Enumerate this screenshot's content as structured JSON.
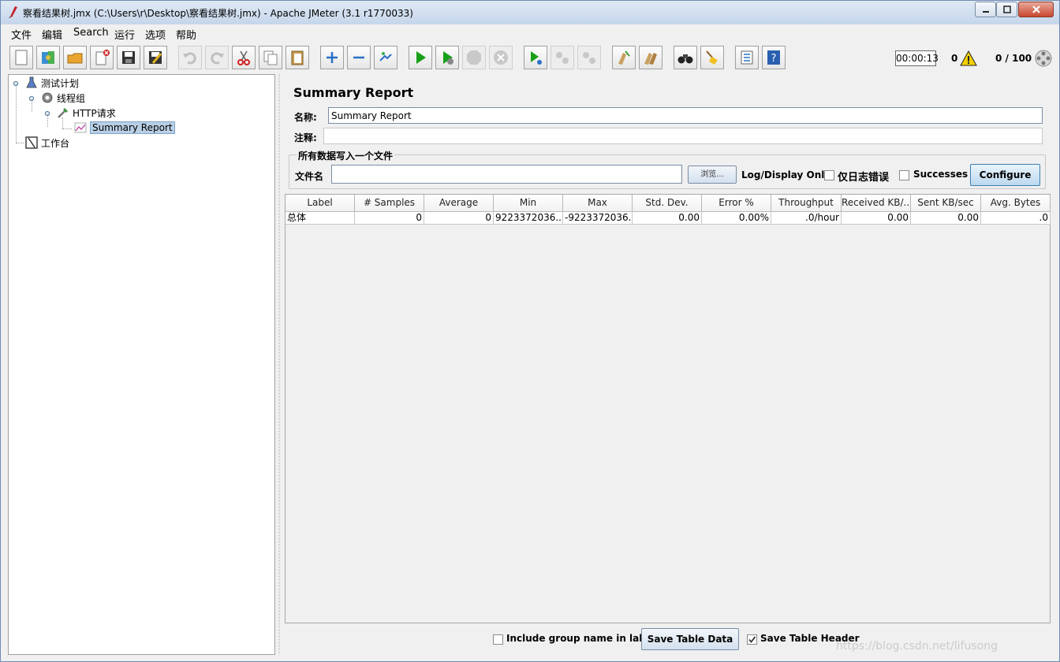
{
  "window": {
    "title": "察看结果树.jmx (C:\\Users\\r\\Desktop\\察看结果树.jmx) - Apache JMeter (3.1 r1770033)"
  },
  "menu": [
    "文件",
    "编辑",
    "Search",
    "运行",
    "选项",
    "帮助"
  ],
  "toolbar": {
    "icons": [
      "new-icon",
      "templates-icon",
      "open-icon",
      "close-file-icon",
      "save-icon",
      "save-as-icon",
      "undo-icon",
      "redo-icon",
      "cut-icon",
      "copy-icon",
      "paste-icon",
      "expand-icon",
      "collapse-icon",
      "toggle-icon",
      "start-icon",
      "start-no-pauses-icon",
      "stop-icon",
      "shutdown-icon",
      "remote-start-icon",
      "remote-stop-icon",
      "remote-shutdown-icon",
      "clear-icon",
      "clear-all-icon",
      "search-icon",
      "reset-search-icon",
      "function-helper-icon",
      "help-icon"
    ],
    "elapsed_time": "00:00:13",
    "error_count": "0",
    "threads": "0 / 100"
  },
  "tree": {
    "test_plan": "测试计划",
    "thread_group": "线程组",
    "http_request": "HTTP请求",
    "summary_report": "Summary Report",
    "workbench": "工作台"
  },
  "report": {
    "title": "Summary Report",
    "name_label": "名称:",
    "name_value": "Summary Report",
    "comment_label": "注释:",
    "comment_value": "",
    "file_group_title": "所有数据写入一个文件",
    "filename_label": "文件名",
    "filename_value": "",
    "browse_label": "浏览...",
    "log_display_label": "Log/Display Only:",
    "errors_label": "仅日志错误",
    "successes_label": "Successes",
    "configure_label": "Configure"
  },
  "table": {
    "columns": [
      "Label",
      "# Samples",
      "Average",
      "Min",
      "Max",
      "Std. Dev.",
      "Error %",
      "Throughput",
      "Received KB/...",
      "Sent KB/sec",
      "Avg. Bytes"
    ],
    "rows": [
      [
        "总体",
        "0",
        "0",
        "9223372036...",
        "-9223372036...",
        "0.00",
        "0.00%",
        ".0/hour",
        "0.00",
        "0.00",
        ".0"
      ]
    ]
  },
  "bottom": {
    "include_group_label": "Include group name in label?",
    "save_data_label": "Save Table Data",
    "save_header_label": "Save Table Header",
    "save_header_checked": true,
    "watermark": "https://blog.csdn.net/lifusong"
  }
}
